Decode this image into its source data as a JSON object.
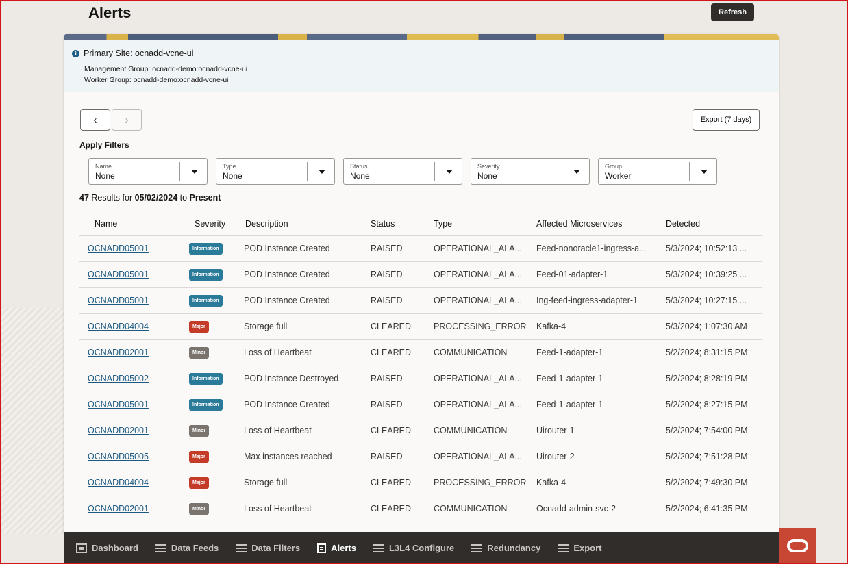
{
  "header": {
    "title": "Alerts",
    "refresh_label": "Refresh"
  },
  "site": {
    "primary_site": "Primary Site: ocnadd-vcne-ui",
    "management_group": "Management Group: ocnadd-demo:ocnadd-vcne-ui",
    "worker_group": "Worker Group: ocnadd-demo:ocnadd-vcne-ui"
  },
  "toolbar": {
    "prev": "‹",
    "next": "›",
    "export_label": "Export (7 days)"
  },
  "filters": {
    "heading": "Apply Filters",
    "items": [
      {
        "label": "Name",
        "value": "None"
      },
      {
        "label": "Type",
        "value": "None"
      },
      {
        "label": "Status",
        "value": "None"
      },
      {
        "label": "Severity",
        "value": "None"
      },
      {
        "label": "Group",
        "value": "Worker"
      }
    ]
  },
  "results": {
    "count": "47",
    "text1": " Results for ",
    "date": "05/02/2024",
    "text2": " to ",
    "end": "Present"
  },
  "table": {
    "columns": [
      "Name",
      "Severity",
      "Description",
      "Status",
      "Type",
      "Affected Microservices",
      "Detected"
    ],
    "rows": [
      {
        "name": "OCNADD05001",
        "severity": "Information",
        "description": "POD Instance Created",
        "status": "RAISED",
        "type": "OPERATIONAL_ALA...",
        "ms": "Feed-nonoracle1-ingress-a...",
        "detected": "5/3/2024; 10:52:13 ..."
      },
      {
        "name": "OCNADD05001",
        "severity": "Information",
        "description": "POD Instance Created",
        "status": "RAISED",
        "type": "OPERATIONAL_ALA...",
        "ms": "Feed-01-adapter-1",
        "detected": "5/3/2024; 10:39:25 ..."
      },
      {
        "name": "OCNADD05001",
        "severity": "Information",
        "description": "POD Instance Created",
        "status": "RAISED",
        "type": "OPERATIONAL_ALA...",
        "ms": "Ing-feed-ingress-adapter-1",
        "detected": "5/3/2024; 10:27:15 ..."
      },
      {
        "name": "OCNADD04004",
        "severity": "Major",
        "description": "Storage full",
        "status": "CLEARED",
        "type": "PROCESSING_ERROR",
        "ms": "Kafka-4",
        "detected": "5/3/2024; 1:07:30 AM"
      },
      {
        "name": "OCNADD02001",
        "severity": "Minor",
        "description": "Loss of Heartbeat",
        "status": "CLEARED",
        "type": "COMMUNICATION",
        "ms": "Feed-1-adapter-1",
        "detected": "5/2/2024; 8:31:15 PM"
      },
      {
        "name": "OCNADD05002",
        "severity": "Information",
        "description": "POD Instance Destroyed",
        "status": "RAISED",
        "type": "OPERATIONAL_ALA...",
        "ms": "Feed-1-adapter-1",
        "detected": "5/2/2024; 8:28:19 PM"
      },
      {
        "name": "OCNADD05001",
        "severity": "Information",
        "description": "POD Instance Created",
        "status": "RAISED",
        "type": "OPERATIONAL_ALA...",
        "ms": "Feed-1-adapter-1",
        "detected": "5/2/2024; 8:27:15 PM"
      },
      {
        "name": "OCNADD02001",
        "severity": "Minor",
        "description": "Loss of Heartbeat",
        "status": "CLEARED",
        "type": "COMMUNICATION",
        "ms": "Uirouter-1",
        "detected": "5/2/2024; 7:54:00 PM"
      },
      {
        "name": "OCNADD05005",
        "severity": "Major",
        "description": "Max instances reached",
        "status": "RAISED",
        "type": "OPERATIONAL_ALA...",
        "ms": "Uirouter-2",
        "detected": "5/2/2024; 7:51:28 PM"
      },
      {
        "name": "OCNADD04004",
        "severity": "Major",
        "description": "Storage full",
        "status": "CLEARED",
        "type": "PROCESSING_ERROR",
        "ms": "Kafka-4",
        "detected": "5/2/2024; 7:49:30 PM"
      },
      {
        "name": "OCNADD02001",
        "severity": "Minor",
        "description": "Loss of Heartbeat",
        "status": "CLEARED",
        "type": "COMMUNICATION",
        "ms": "Ocnadd-admin-svc-2",
        "detected": "5/2/2024; 6:41:35 PM"
      }
    ]
  },
  "severity_colors": {
    "Information": "#2a7a9a",
    "Major": "#c43b28",
    "Minor": "#7a736e"
  },
  "bottom_nav": [
    {
      "label": "Dashboard",
      "icon": "dashboard-icon"
    },
    {
      "label": "Data Feeds",
      "icon": "list-icon"
    },
    {
      "label": "Data Filters",
      "icon": "list-icon"
    },
    {
      "label": "Alerts",
      "icon": "document-icon",
      "active": true
    },
    {
      "label": "L3L4 Configure",
      "icon": "tools-icon"
    },
    {
      "label": "Redundancy",
      "icon": "list-icon"
    },
    {
      "label": "Export",
      "icon": "list-icon"
    }
  ]
}
